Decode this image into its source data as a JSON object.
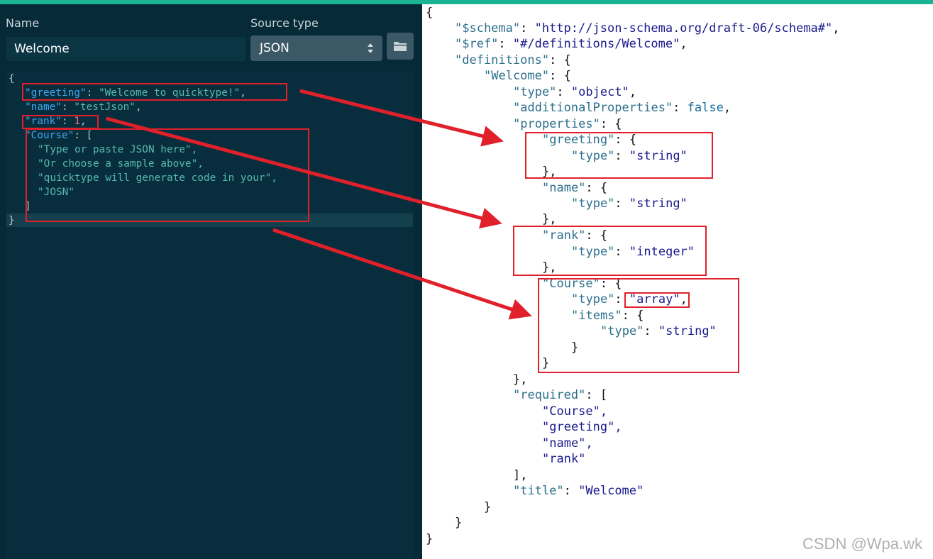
{
  "form": {
    "name_label": "Name",
    "name_value": "Welcome",
    "source_type_label": "Source type",
    "source_type_value": "JSON"
  },
  "icons": {
    "folder": "folder-icon",
    "select_arrows": "updown-arrows-icon"
  },
  "colors": {
    "accent_bar": "#1ab394",
    "editor_bg": "#082e3d",
    "annotation_red": "#e0202a"
  },
  "input_json": {
    "l1": "{",
    "greeting_key": "\"greeting\"",
    "greeting_value": "\"Welcome to quicktype!\"",
    "name_key": "\"name\"",
    "name_value": "\"testJson\"",
    "rank_key": "\"rank\"",
    "rank_value": "1",
    "course_key": "\"Course\"",
    "course_items": [
      "\"Type or paste JSON here\",",
      "\"Or choose a sample above\",",
      "\"quicktype will generate code in your\",",
      "\"JOSN\""
    ],
    "close_array": "]",
    "close_obj": "}"
  },
  "schema": {
    "schema_key": "\"$schema\"",
    "schema_value": "\"http://json-schema.org/draft-06/schema#\"",
    "ref_key": "\"$ref\"",
    "ref_value": "\"#/definitions/Welcome\"",
    "definitions_key": "\"definitions\"",
    "welcome_key": "\"Welcome\"",
    "type_key": "\"type\"",
    "object_value": "\"object\"",
    "additional_key": "\"additionalProperties\"",
    "false_value": "false",
    "properties_key": "\"properties\"",
    "greeting_key": "\"greeting\"",
    "string_value": "\"string\"",
    "name_key": "\"name\"",
    "rank_key": "\"rank\"",
    "integer_value": "\"integer\"",
    "course_key": "\"Course\"",
    "array_value": "\"array\"",
    "items_key": "\"items\"",
    "required_key": "\"required\"",
    "required_list": [
      "\"Course\",",
      "\"greeting\",",
      "\"name\",",
      "\"rank\""
    ],
    "title_key": "\"title\"",
    "title_value": "\"Welcome\""
  },
  "watermark": "CSDN @Wpa.wk"
}
